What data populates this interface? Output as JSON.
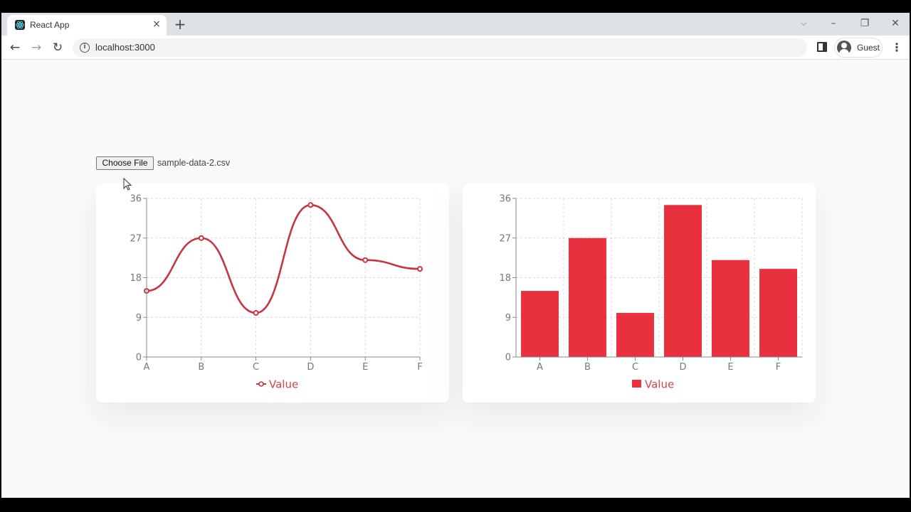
{
  "browser": {
    "tab_title": "React App",
    "tab_close": "×",
    "new_tab": "+",
    "url": "localhost:3000",
    "profile_name": "Guest",
    "icons": [
      "react-favicon",
      "back-arrow-icon",
      "forward-arrow-icon",
      "reload-icon",
      "info-icon",
      "side-panel-icon",
      "avatar-icon",
      "kebab-menu-icon",
      "minimize-icon",
      "restore-icon",
      "close-icon",
      "tab-search-icon"
    ]
  },
  "upload": {
    "button_label": "Choose File",
    "file_name": "sample-data-2.csv"
  },
  "colors": {
    "line": "#c63542",
    "bar": "#e8303f",
    "legend_text": "#d8414d",
    "grid": "#d9d9d9"
  },
  "chart_data": [
    {
      "type": "line",
      "categories": [
        "A",
        "B",
        "C",
        "D",
        "E",
        "F"
      ],
      "series": [
        {
          "name": "Value",
          "values": [
            15,
            27,
            10,
            34.5,
            22,
            20
          ]
        }
      ],
      "yticks": [
        "0",
        "9",
        "18",
        "27",
        "36"
      ],
      "ylim": [
        0,
        36
      ],
      "grid": true,
      "legend": "bottom-center"
    },
    {
      "type": "bar",
      "categories": [
        "A",
        "B",
        "C",
        "D",
        "E",
        "F"
      ],
      "series": [
        {
          "name": "Value",
          "values": [
            15,
            27,
            10,
            34.5,
            22,
            20
          ]
        }
      ],
      "yticks": [
        "0",
        "9",
        "18",
        "27",
        "36"
      ],
      "ylim": [
        0,
        36
      ],
      "grid": true,
      "legend": "bottom-center"
    }
  ]
}
